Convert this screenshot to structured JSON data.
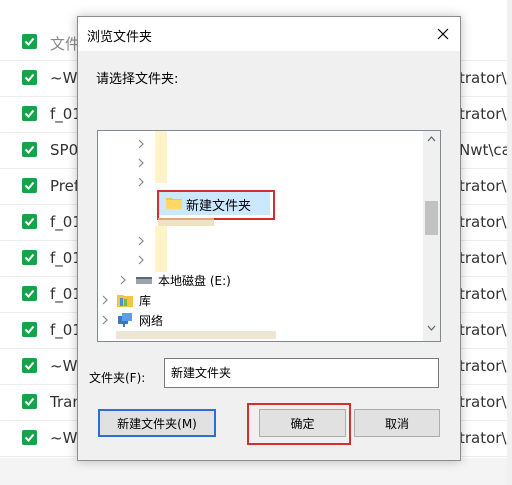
{
  "background_list": {
    "header": {
      "left": "文件",
      "right": ""
    },
    "rows": [
      {
        "left": "~W",
        "right": "trator\\A"
      },
      {
        "left": "f_01",
        "right": "trator\\A"
      },
      {
        "left": "SP0",
        "right": "Nwt\\cacl"
      },
      {
        "left": "Pref",
        "right": "trator\\A"
      },
      {
        "left": "f_01",
        "right": "trator\\A"
      },
      {
        "left": "f_01",
        "right": "trator\\A"
      },
      {
        "left": "f_01",
        "right": "trator\\A"
      },
      {
        "left": "f_01",
        "right": "trator\\A"
      },
      {
        "left": "~W",
        "right": "trator\\A"
      },
      {
        "left": "Tran",
        "right": "trator\\A"
      },
      {
        "left": "~W",
        "right": "trator\\A"
      }
    ]
  },
  "dialog": {
    "title": "浏览文件夹",
    "prompt": "请选择文件夹:",
    "tree": {
      "selected": "新建文件夹",
      "drive": "本地磁盘 (E:)",
      "library": "库",
      "network": "网络"
    },
    "folder_label": "文件夹(F):",
    "folder_value": "新建文件夹",
    "buttons": {
      "new_folder": "新建文件夹(M)",
      "ok": "确定",
      "cancel": "取消"
    }
  },
  "colors": {
    "checkbox": "#18a34a",
    "highlight_box": "#d32f2f",
    "selection": "#cce8ff",
    "focus_border": "#2a6fd6"
  }
}
